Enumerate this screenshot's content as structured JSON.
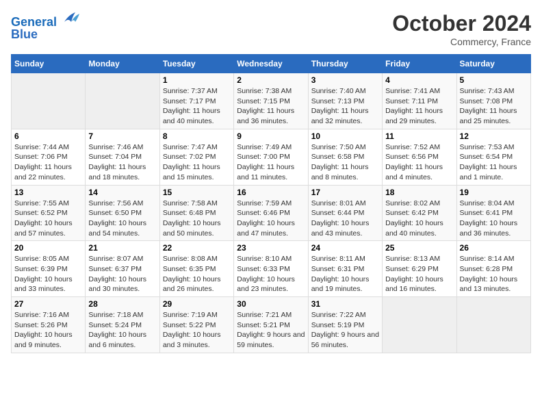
{
  "header": {
    "logo_line1": "General",
    "logo_line2": "Blue",
    "month": "October 2024",
    "location": "Commercy, France"
  },
  "days_of_week": [
    "Sunday",
    "Monday",
    "Tuesday",
    "Wednesday",
    "Thursday",
    "Friday",
    "Saturday"
  ],
  "weeks": [
    [
      {
        "day": "",
        "detail": ""
      },
      {
        "day": "",
        "detail": ""
      },
      {
        "day": "1",
        "detail": "Sunrise: 7:37 AM\nSunset: 7:17 PM\nDaylight: 11 hours and 40 minutes."
      },
      {
        "day": "2",
        "detail": "Sunrise: 7:38 AM\nSunset: 7:15 PM\nDaylight: 11 hours and 36 minutes."
      },
      {
        "day": "3",
        "detail": "Sunrise: 7:40 AM\nSunset: 7:13 PM\nDaylight: 11 hours and 32 minutes."
      },
      {
        "day": "4",
        "detail": "Sunrise: 7:41 AM\nSunset: 7:11 PM\nDaylight: 11 hours and 29 minutes."
      },
      {
        "day": "5",
        "detail": "Sunrise: 7:43 AM\nSunset: 7:08 PM\nDaylight: 11 hours and 25 minutes."
      }
    ],
    [
      {
        "day": "6",
        "detail": "Sunrise: 7:44 AM\nSunset: 7:06 PM\nDaylight: 11 hours and 22 minutes."
      },
      {
        "day": "7",
        "detail": "Sunrise: 7:46 AM\nSunset: 7:04 PM\nDaylight: 11 hours and 18 minutes."
      },
      {
        "day": "8",
        "detail": "Sunrise: 7:47 AM\nSunset: 7:02 PM\nDaylight: 11 hours and 15 minutes."
      },
      {
        "day": "9",
        "detail": "Sunrise: 7:49 AM\nSunset: 7:00 PM\nDaylight: 11 hours and 11 minutes."
      },
      {
        "day": "10",
        "detail": "Sunrise: 7:50 AM\nSunset: 6:58 PM\nDaylight: 11 hours and 8 minutes."
      },
      {
        "day": "11",
        "detail": "Sunrise: 7:52 AM\nSunset: 6:56 PM\nDaylight: 11 hours and 4 minutes."
      },
      {
        "day": "12",
        "detail": "Sunrise: 7:53 AM\nSunset: 6:54 PM\nDaylight: 11 hours and 1 minute."
      }
    ],
    [
      {
        "day": "13",
        "detail": "Sunrise: 7:55 AM\nSunset: 6:52 PM\nDaylight: 10 hours and 57 minutes."
      },
      {
        "day": "14",
        "detail": "Sunrise: 7:56 AM\nSunset: 6:50 PM\nDaylight: 10 hours and 54 minutes."
      },
      {
        "day": "15",
        "detail": "Sunrise: 7:58 AM\nSunset: 6:48 PM\nDaylight: 10 hours and 50 minutes."
      },
      {
        "day": "16",
        "detail": "Sunrise: 7:59 AM\nSunset: 6:46 PM\nDaylight: 10 hours and 47 minutes."
      },
      {
        "day": "17",
        "detail": "Sunrise: 8:01 AM\nSunset: 6:44 PM\nDaylight: 10 hours and 43 minutes."
      },
      {
        "day": "18",
        "detail": "Sunrise: 8:02 AM\nSunset: 6:42 PM\nDaylight: 10 hours and 40 minutes."
      },
      {
        "day": "19",
        "detail": "Sunrise: 8:04 AM\nSunset: 6:41 PM\nDaylight: 10 hours and 36 minutes."
      }
    ],
    [
      {
        "day": "20",
        "detail": "Sunrise: 8:05 AM\nSunset: 6:39 PM\nDaylight: 10 hours and 33 minutes."
      },
      {
        "day": "21",
        "detail": "Sunrise: 8:07 AM\nSunset: 6:37 PM\nDaylight: 10 hours and 30 minutes."
      },
      {
        "day": "22",
        "detail": "Sunrise: 8:08 AM\nSunset: 6:35 PM\nDaylight: 10 hours and 26 minutes."
      },
      {
        "day": "23",
        "detail": "Sunrise: 8:10 AM\nSunset: 6:33 PM\nDaylight: 10 hours and 23 minutes."
      },
      {
        "day": "24",
        "detail": "Sunrise: 8:11 AM\nSunset: 6:31 PM\nDaylight: 10 hours and 19 minutes."
      },
      {
        "day": "25",
        "detail": "Sunrise: 8:13 AM\nSunset: 6:29 PM\nDaylight: 10 hours and 16 minutes."
      },
      {
        "day": "26",
        "detail": "Sunrise: 8:14 AM\nSunset: 6:28 PM\nDaylight: 10 hours and 13 minutes."
      }
    ],
    [
      {
        "day": "27",
        "detail": "Sunrise: 7:16 AM\nSunset: 5:26 PM\nDaylight: 10 hours and 9 minutes."
      },
      {
        "day": "28",
        "detail": "Sunrise: 7:18 AM\nSunset: 5:24 PM\nDaylight: 10 hours and 6 minutes."
      },
      {
        "day": "29",
        "detail": "Sunrise: 7:19 AM\nSunset: 5:22 PM\nDaylight: 10 hours and 3 minutes."
      },
      {
        "day": "30",
        "detail": "Sunrise: 7:21 AM\nSunset: 5:21 PM\nDaylight: 9 hours and 59 minutes."
      },
      {
        "day": "31",
        "detail": "Sunrise: 7:22 AM\nSunset: 5:19 PM\nDaylight: 9 hours and 56 minutes."
      },
      {
        "day": "",
        "detail": ""
      },
      {
        "day": "",
        "detail": ""
      }
    ]
  ]
}
